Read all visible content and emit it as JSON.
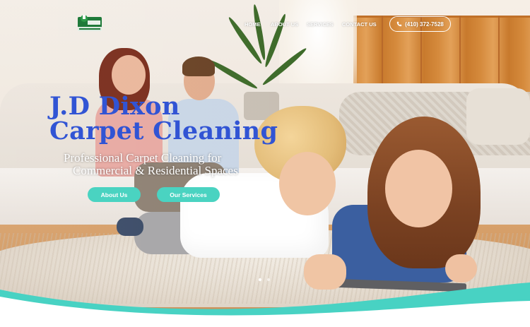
{
  "header": {
    "logo_alt": "JD Dixon",
    "nav": [
      "HOME",
      "ABOUT US",
      "SERVICES",
      "CONTACT US"
    ],
    "phone": "(410) 372-7528"
  },
  "hero": {
    "title_line1": "J.D Dixon",
    "title_line2": "Carpet Cleaning",
    "subtitle_line1": "Professional Carpet Cleaning for",
    "subtitle_line2": "Commercial & Residential Spaces",
    "buttons": [
      "About Us",
      "Our Services"
    ],
    "slider_dots": 2,
    "active_slide": 1
  },
  "colors": {
    "title": "#3154d4",
    "accent": "#4ad3c1"
  }
}
